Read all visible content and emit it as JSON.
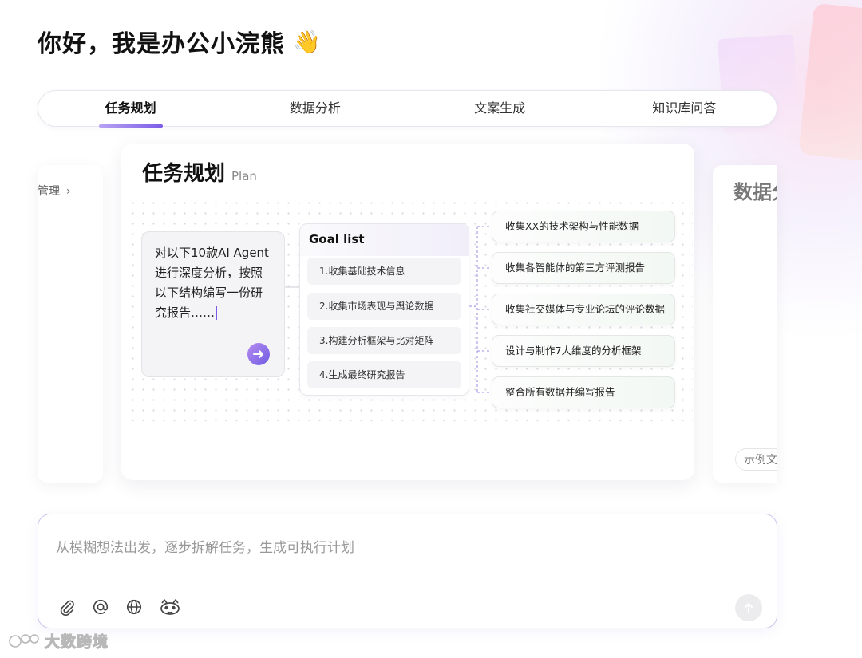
{
  "greeting": {
    "text": "你好，我是办公小浣熊",
    "emoji": "👋"
  },
  "tabs": [
    {
      "label": "任务规划",
      "active": true
    },
    {
      "label": "数据分析",
      "active": false
    },
    {
      "label": "文案生成",
      "active": false
    },
    {
      "label": "知识库问答",
      "active": false
    }
  ],
  "carousel": {
    "left_card": {
      "text": "管理"
    },
    "right_card": {
      "title": "数据分",
      "chip": "示例文"
    },
    "main_card": {
      "title": "任务规划",
      "subtitle": "Plan",
      "prompt_text": "对以下10款AI Agent进行深度分析，按照以下结构编写一份研究报告……",
      "goal_list": {
        "title": "Goal list",
        "items": [
          "1.收集基础技术信息",
          "2.收集市场表现与舆论数据",
          "3.构建分析框架与比对矩阵",
          "4.生成最终研究报告"
        ]
      },
      "results": [
        "收集XX的技术架构与性能数据",
        "收集各智能体的第三方评测报告",
        "收集社交媒体与专业论坛的评论数据",
        "设计与制作7大维度的分析框架",
        "整合所有数据并编写报告"
      ]
    }
  },
  "input": {
    "placeholder": "从模糊想法出发，逐步拆解任务，生成可执行计划",
    "tools": [
      "attachment-icon",
      "at-mention-icon",
      "globe-icon",
      "raccoon-icon"
    ]
  },
  "watermark": {
    "text": "大数跨境"
  },
  "colors": {
    "accent": "#7b5ce8",
    "border": "#cdc6ea"
  }
}
